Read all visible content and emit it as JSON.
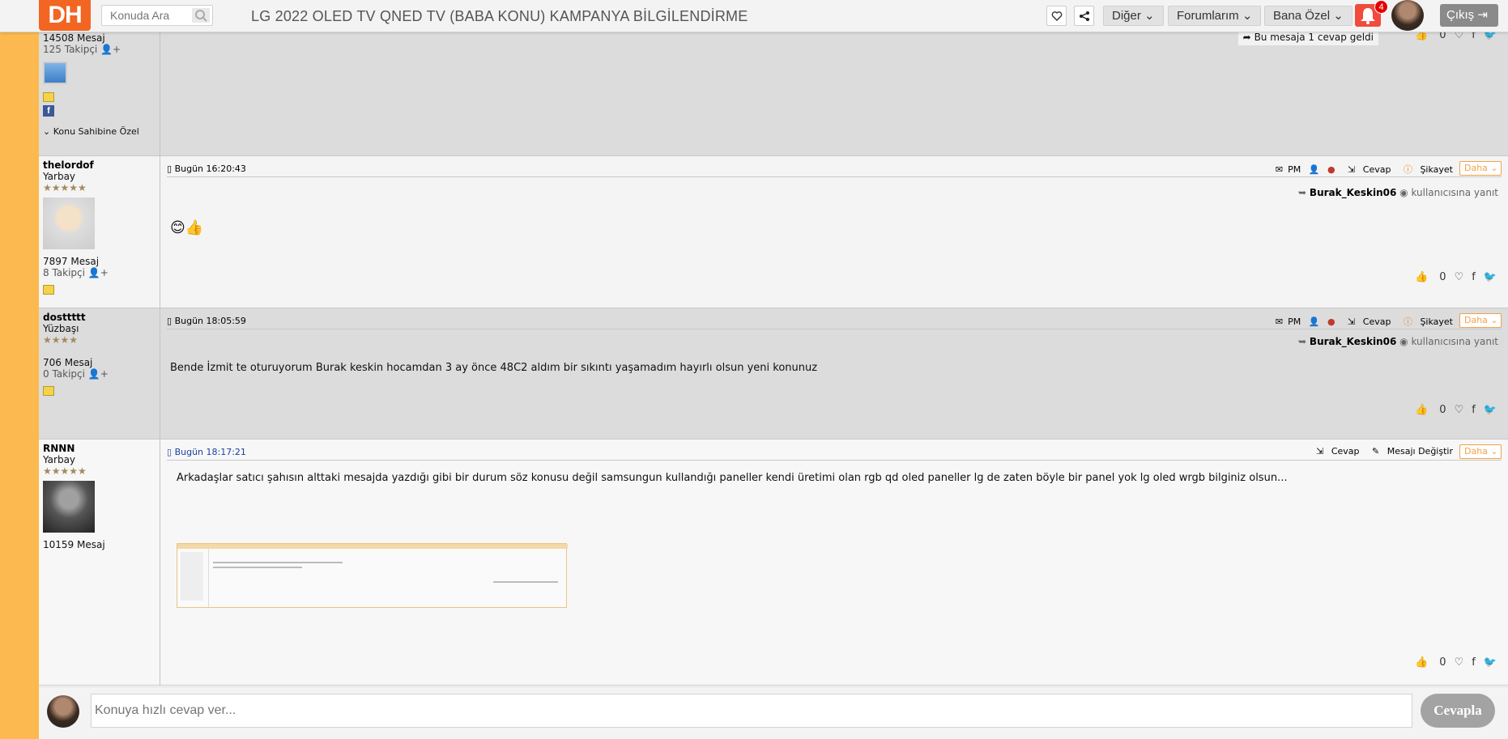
{
  "header": {
    "logo": "DH",
    "search_placeholder": "Konuda Ara",
    "title": "LG 2022 OLED TV QNED TV (BABA KONU) KAMPANYA BİLGİLENDİRME",
    "menu_other": "Diğer",
    "menu_forums": "Forumlarım",
    "menu_personal": "Bana Özel",
    "notification_count": "4",
    "logout": "Çıkış"
  },
  "posts": [
    {
      "user": {
        "messages": "14508 Mesaj",
        "followers": "125 Takipçi"
      },
      "owner_special": "Konu Sahibine Özel",
      "replied_note": "Bu mesaja 1 cevap geldi",
      "likes": "0"
    },
    {
      "user": {
        "name": "thelordof",
        "rank": "Yarbay",
        "messages": "7897 Mesaj",
        "followers": "8 Takipçi"
      },
      "time": "Bugün 16:20:43",
      "actions": {
        "pm": "PM",
        "reply": "Cevap",
        "report": "Şikayet",
        "more": "Daha"
      },
      "reply_to_user": "Burak_Keskin06",
      "reply_to_suffix": "kullanıcısına yanıt",
      "likes": "0"
    },
    {
      "user": {
        "name": "dosttttt",
        "rank": "Yüzbaşı",
        "messages": "706 Mesaj",
        "followers": "0 Takipçi"
      },
      "time": "Bugün 18:05:59",
      "actions": {
        "pm": "PM",
        "reply": "Cevap",
        "report": "Şikayet",
        "more": "Daha"
      },
      "reply_to_user": "Burak_Keskin06",
      "reply_to_suffix": "kullanıcısına yanıt",
      "text": "Bende İzmit te oturuyorum Burak keskin hocamdan 3 ay önce 48C2 aldım bir sıkıntı yaşamadım hayırlı olsun yeni konunuz",
      "likes": "0"
    },
    {
      "user": {
        "name": "RNNN",
        "rank": "Yarbay",
        "messages": "10159 Mesaj"
      },
      "time": "Bugün 18:17:21",
      "actions": {
        "reply": "Cevap",
        "edit": "Mesajı Değiştir",
        "more": "Daha"
      },
      "text": "Arkadaşlar satıcı şahısın alttaki mesajda yazdığı gibi bir durum söz konusu değil samsungun kullandığı paneller kendi üretimi olan rgb qd oled paneller lg de zaten böyle bir panel yok lg oled wrgb bilginiz olsun...",
      "likes": "0"
    }
  ],
  "quick_reply": {
    "placeholder": "Konuya hızlı cevap ver...",
    "submit": "Cevapla"
  },
  "colors": {
    "accent": "#f26522",
    "page_bg": "#fbb94f",
    "post_grey": "#dcdcdc",
    "bell": "#f04b3c"
  }
}
